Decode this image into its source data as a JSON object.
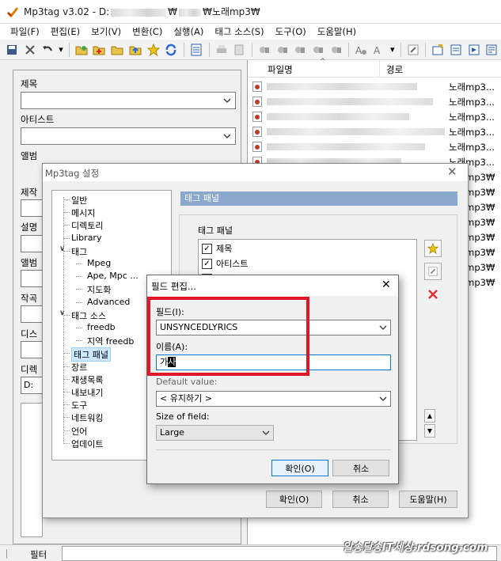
{
  "window": {
    "title_prefix": "Mp3tag v3.02  -  D:",
    "title_suffix": "₩노래mp3₩",
    "title_sep": "₩"
  },
  "menu": [
    "파일(F)",
    "편집(E)",
    "보기(V)",
    "변환(C)",
    "실행(A)",
    "태그 소스(S)",
    "도구(O)",
    "도움말(H)"
  ],
  "left_panel": {
    "fields": [
      {
        "label": "제목"
      },
      {
        "label": "아티스트"
      },
      {
        "label": "앨범"
      },
      {
        "label": "제작"
      },
      {
        "label": "설명"
      },
      {
        "label": "앨범"
      },
      {
        "label": "작곡"
      },
      {
        "label": "디스"
      },
      {
        "label": "디렉"
      }
    ],
    "dir_value": "D:"
  },
  "file_list": {
    "col_filename": "파일명",
    "col_path": "경로",
    "path_text": "노래mp3...",
    "path_text_short": "노래mp3₩",
    "row_count": 14
  },
  "settings_dialog": {
    "title": "Mp3tag 설정",
    "tree": [
      {
        "label": "일반",
        "level": 0
      },
      {
        "label": "메시지",
        "level": 0
      },
      {
        "label": "디렉토리",
        "level": 0
      },
      {
        "label": "Library",
        "level": 0
      },
      {
        "label": "태그",
        "level": 0,
        "expanded": true
      },
      {
        "label": "Mpeg",
        "level": 1
      },
      {
        "label": "Ape, Mpc ...",
        "level": 1
      },
      {
        "label": "지도화",
        "level": 1
      },
      {
        "label": "Advanced",
        "level": 1
      },
      {
        "label": "태그 소스",
        "level": 0,
        "expanded": true
      },
      {
        "label": "freedb",
        "level": 1
      },
      {
        "label": "지역 freedb",
        "level": 1
      },
      {
        "label": "태그 패널",
        "level": 0,
        "selected": true
      },
      {
        "label": "장르",
        "level": 0
      },
      {
        "label": "재생목록",
        "level": 0
      },
      {
        "label": "내보내기",
        "level": 0
      },
      {
        "label": "도구",
        "level": 0
      },
      {
        "label": "네트워킹",
        "level": 0
      },
      {
        "label": "언어",
        "level": 0
      },
      {
        "label": "업데이트",
        "level": 0
      }
    ],
    "panel_header": "태그 패널",
    "group_label": "태그 패널",
    "tag_items": [
      {
        "label": "제목",
        "checked": true
      },
      {
        "label": "아티스트",
        "checked": true
      },
      {
        "label": "앨범",
        "checked": true
      }
    ],
    "ok": "확인(O)",
    "cancel": "취소",
    "help": "도움말(H)"
  },
  "field_edit": {
    "title": "필드 편집...",
    "field_label": "필드(I):",
    "field_value": "UNSYNCEDLYRICS",
    "name_label": "이름(A):",
    "name_value_plain": "가",
    "name_value_selected": "사",
    "default_label": "Default value:",
    "default_value": "< 유지하기 >",
    "size_label": "Size of field:",
    "size_value": "Large",
    "ok": "확인(O)",
    "cancel": "취소"
  },
  "statusbar": {
    "filter_label": "필터"
  },
  "watermark": "알송달송IT세상.rdsong.com",
  "colors": {
    "accent_red_box": "#e0162b",
    "panel_header": "#8aa7cc",
    "selection": "#0078d7"
  }
}
